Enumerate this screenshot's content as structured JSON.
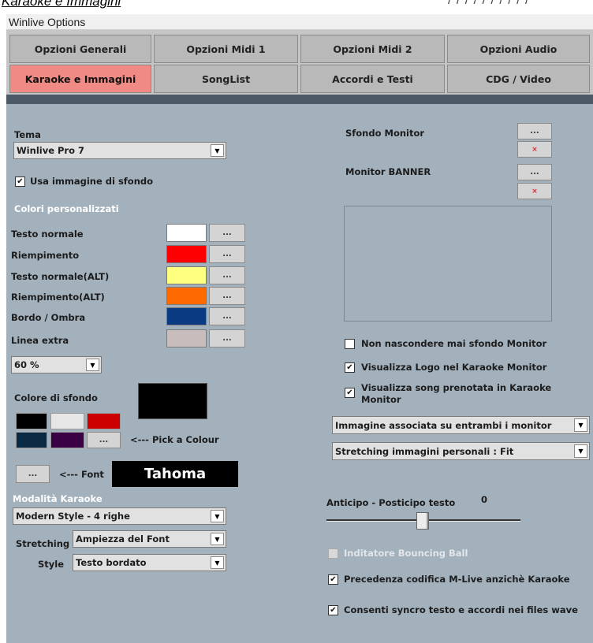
{
  "doc_heading": "Karaoke e Immagini",
  "doc_heading_right": "/ / / / / / / / / /",
  "menu": {
    "title": "Winlive Options"
  },
  "tabs": [
    {
      "label": "Opzioni Generali",
      "active": false
    },
    {
      "label": "Opzioni Midi 1",
      "active": false
    },
    {
      "label": "Opzioni Midi 2",
      "active": false
    },
    {
      "label": "Opzioni Audio",
      "active": false
    },
    {
      "label": "Karaoke e Immagini",
      "active": true
    },
    {
      "label": "SongList",
      "active": false
    },
    {
      "label": "Accordi e Testi",
      "active": false
    },
    {
      "label": "CDG / Video",
      "active": false
    }
  ],
  "left": {
    "tema_label": "Tema",
    "tema_value": "Winlive Pro 7",
    "usa_immagine_label": "Usa immagine di sfondo",
    "usa_immagine_checked": true,
    "colori_label": "Colori personalizzati",
    "colors": [
      {
        "label": "Testo normale",
        "color": "#ffffff"
      },
      {
        "label": "Riempimento",
        "color": "#ff0000"
      },
      {
        "label": "Testo normale(ALT)",
        "color": "#ffff80"
      },
      {
        "label": "Riempimento(ALT)",
        "color": "#ff6a00"
      },
      {
        "label": "Bordo / Ombra",
        "color": "#0a3a82"
      },
      {
        "label": "Linea extra",
        "color": "#c9bcbc"
      }
    ],
    "dots": "...",
    "percent_value": "60 %",
    "colore_sfondo_label": "Colore di sfondo",
    "colore_sfondo_color": "#000000",
    "palette": [
      "#000000",
      "#e6e6e6",
      "#cc0000",
      "#0a2a44",
      "#3a0044"
    ],
    "pick_colour_label": "<--- Pick a Colour",
    "font_label": "<--- Font",
    "font_sample": "Tahoma",
    "modalita_label": "Modalità Karaoke",
    "modalita_value": "Modern Style - 4 righe",
    "stretching_label": "Stretching",
    "stretching_value": "Ampiezza del Font",
    "style_label": "Style",
    "style_value": "Testo bordato"
  },
  "right": {
    "sfondo_monitor_label": "Sfondo Monitor",
    "monitor_banner_label": "Monitor BANNER",
    "x_mark": "×",
    "checks": [
      {
        "label": "Non nascondere mai sfondo Monitor",
        "checked": false
      },
      {
        "label": "Visualizza Logo nel Karaoke Monitor",
        "checked": true
      },
      {
        "label": "Visualizza song prenotata in Karaoke Monitor",
        "checked": true
      }
    ],
    "immagine_select": "Immagine associata su entrambi i monitor",
    "stretching_select": "Stretching immagini personali : Fit",
    "anticipo_label": "Anticipo - Posticipo testo",
    "anticipo_value": "0",
    "slider_fraction": 0.5,
    "bouncing_label": "Inditatore Bouncing Ball",
    "precedenza_label": "Precedenza codifica M-Live anzichè Karaoke",
    "consenti_label": "Consenti syncro testo e accordi nei files wave",
    "check_mark": "✔"
  }
}
